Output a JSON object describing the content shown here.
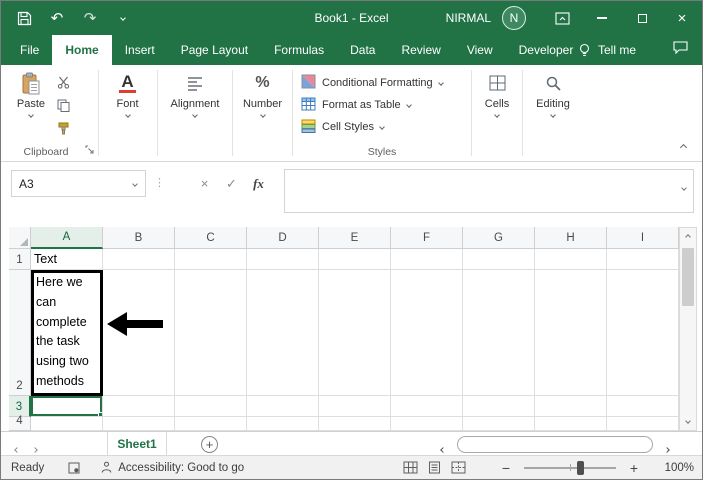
{
  "titlebar": {
    "title": "Book1  -  Excel",
    "user_name": "NIRMAL",
    "avatar_letter": "N"
  },
  "icons": {
    "undo": "↶",
    "redo": "↷",
    "cancel": "×",
    "enter": "✓",
    "font_letter": "A",
    "percent": "%",
    "new_sheet": "+",
    "zoom_out": "−",
    "zoom_in": "+",
    "close_window": "×",
    "vdots": "⋮"
  },
  "tabs": {
    "items": [
      {
        "label": "File"
      },
      {
        "label": "Home"
      },
      {
        "label": "Insert"
      },
      {
        "label": "Page Layout"
      },
      {
        "label": "Formulas"
      },
      {
        "label": "Data"
      },
      {
        "label": "Review"
      },
      {
        "label": "View"
      },
      {
        "label": "Developer"
      }
    ],
    "tell_me_label": "Tell me"
  },
  "ribbon": {
    "clipboard": {
      "paste_label": "Paste",
      "group_label": "Clipboard"
    },
    "font": {
      "label": "Font"
    },
    "alignment": {
      "label": "Alignment"
    },
    "number": {
      "label": "Number"
    },
    "styles": {
      "group_label": "Styles",
      "items": [
        {
          "label": "Conditional Formatting"
        },
        {
          "label": "Format as Table"
        },
        {
          "label": "Cell Styles"
        }
      ]
    },
    "cells": {
      "label": "Cells"
    },
    "editing": {
      "label": "Editing"
    }
  },
  "formula_bar": {
    "name_box_value": "A3",
    "fx_label": "fx",
    "formula_value": ""
  },
  "grid": {
    "columns": [
      "A",
      "B",
      "C",
      "D",
      "E",
      "F",
      "G",
      "H",
      "I"
    ],
    "rows": [
      "1",
      "2",
      "3",
      "4"
    ],
    "cells": {
      "A1": "Text",
      "A2": "Here we can complete the task using two methods"
    }
  },
  "sheet_bar": {
    "sheet_tab": "Sheet1"
  },
  "status_bar": {
    "mode": "Ready",
    "accessibility": "Accessibility: Good to go",
    "zoom_level": "100%"
  }
}
